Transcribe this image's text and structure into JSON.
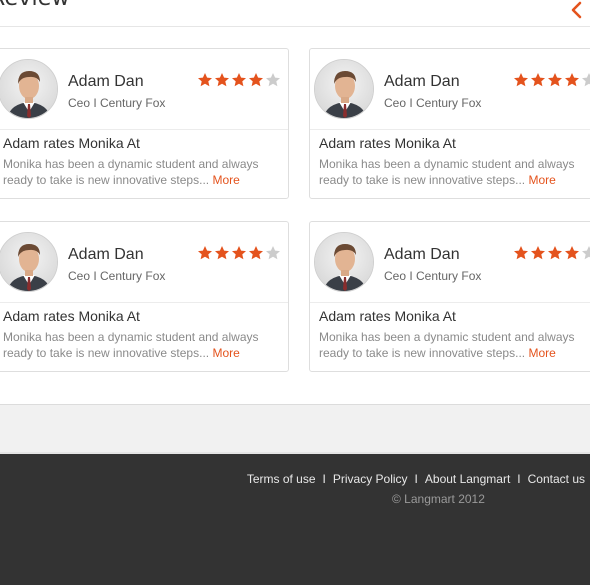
{
  "section": {
    "title": "Review",
    "back_icon": "chevron-left-icon",
    "accent": "#e4531d"
  },
  "reviews": [
    {
      "name": "Adam Dan",
      "role": "Ceo I Century Fox",
      "rating": 4,
      "rating_max": 5,
      "headline": "Adam rates Monika At",
      "body": "Monika has been a dynamic student and always ready to take is new innovative steps...",
      "more_label": "More"
    },
    {
      "name": "Adam Dan",
      "role": "Ceo I Century Fox",
      "rating": 4,
      "rating_max": 5,
      "headline": "Adam rates Monika At",
      "body": "Monika has been a dynamic student and always ready to take is new innovative steps...",
      "more_label": "More"
    },
    {
      "name": "Adam Dan",
      "role": "Ceo I Century Fox",
      "rating": 4,
      "rating_max": 5,
      "headline": "Adam rates Monika At",
      "body": "Monika has been a dynamic student and always ready to take is new innovative steps...",
      "more_label": "More"
    },
    {
      "name": "Adam Dan",
      "role": "Ceo I Century Fox",
      "rating": 4,
      "rating_max": 5,
      "headline": "Adam rates Monika At",
      "body": "Monika has been a dynamic student and always ready to take is new innovative steps...",
      "more_label": "More"
    }
  ],
  "footer": {
    "links": [
      "Terms of use",
      "Privacy Policy",
      "About Langmart",
      "Contact us"
    ],
    "separator": "I",
    "copyright": "© Langmart 2012"
  },
  "colors": {
    "star_filled": "#e4531d",
    "star_empty": "#cccccc",
    "footer_bg": "#333333"
  }
}
